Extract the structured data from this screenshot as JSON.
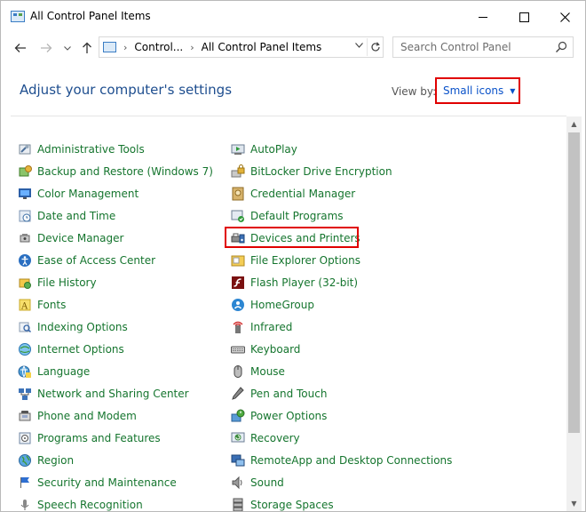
{
  "window": {
    "title": "All Control Panel Items"
  },
  "address": {
    "crumbs": [
      "Control...",
      "All Control Panel Items"
    ]
  },
  "search": {
    "placeholder": "Search Control Panel"
  },
  "header": {
    "title": "Adjust your computer's settings",
    "view_by_label": "View by:",
    "view_by_value": "Small icons"
  },
  "colors": {
    "link_green": "#15752e",
    "heading_blue": "#1e4e8f",
    "select_blue": "#0a52c9",
    "highlight_red": "#e00000"
  },
  "items_left": [
    {
      "label": "Administrative Tools",
      "icon": "administrative-tools-icon"
    },
    {
      "label": "Backup and Restore (Windows 7)",
      "icon": "backup-restore-icon"
    },
    {
      "label": "Color Management",
      "icon": "color-management-icon"
    },
    {
      "label": "Date and Time",
      "icon": "date-time-icon"
    },
    {
      "label": "Device Manager",
      "icon": "device-manager-icon"
    },
    {
      "label": "Ease of Access Center",
      "icon": "ease-of-access-icon"
    },
    {
      "label": "File History",
      "icon": "file-history-icon"
    },
    {
      "label": "Fonts",
      "icon": "fonts-icon"
    },
    {
      "label": "Indexing Options",
      "icon": "indexing-options-icon"
    },
    {
      "label": "Internet Options",
      "icon": "internet-options-icon"
    },
    {
      "label": "Language",
      "icon": "language-icon"
    },
    {
      "label": "Network and Sharing Center",
      "icon": "network-sharing-icon"
    },
    {
      "label": "Phone and Modem",
      "icon": "phone-modem-icon"
    },
    {
      "label": "Programs and Features",
      "icon": "programs-features-icon"
    },
    {
      "label": "Region",
      "icon": "region-icon"
    },
    {
      "label": "Security and Maintenance",
      "icon": "security-maintenance-icon"
    },
    {
      "label": "Speech Recognition",
      "icon": "speech-recognition-icon"
    }
  ],
  "items_right": [
    {
      "label": "AutoPlay",
      "icon": "autoplay-icon"
    },
    {
      "label": "BitLocker Drive Encryption",
      "icon": "bitlocker-icon"
    },
    {
      "label": "Credential Manager",
      "icon": "credential-manager-icon"
    },
    {
      "label": "Default Programs",
      "icon": "default-programs-icon"
    },
    {
      "label": "Devices and Printers",
      "icon": "devices-printers-icon"
    },
    {
      "label": "File Explorer Options",
      "icon": "file-explorer-options-icon"
    },
    {
      "label": "Flash Player (32-bit)",
      "icon": "flash-player-icon"
    },
    {
      "label": "HomeGroup",
      "icon": "homegroup-icon"
    },
    {
      "label": "Infrared",
      "icon": "infrared-icon"
    },
    {
      "label": "Keyboard",
      "icon": "keyboard-icon"
    },
    {
      "label": "Mouse",
      "icon": "mouse-icon"
    },
    {
      "label": "Pen and Touch",
      "icon": "pen-touch-icon"
    },
    {
      "label": "Power Options",
      "icon": "power-options-icon"
    },
    {
      "label": "Recovery",
      "icon": "recovery-icon"
    },
    {
      "label": "RemoteApp and Desktop Connections",
      "icon": "remoteapp-icon"
    },
    {
      "label": "Sound",
      "icon": "sound-icon"
    },
    {
      "label": "Storage Spaces",
      "icon": "storage-spaces-icon"
    }
  ]
}
